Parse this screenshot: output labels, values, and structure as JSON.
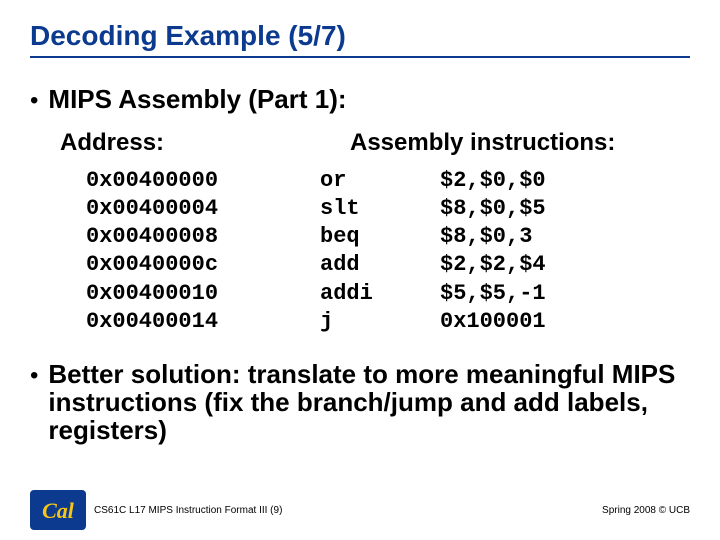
{
  "title": "Decoding Example (5/7)",
  "bullet_main": "MIPS Assembly (Part 1):",
  "column_headers": {
    "address": "Address:",
    "assembly": "Assembly instructions:"
  },
  "rows": [
    {
      "addr": "0x00400000",
      "mnem": "or",
      "args": "$2,$0,$0"
    },
    {
      "addr": "0x00400004",
      "mnem": "slt",
      "args": "$8,$0,$5"
    },
    {
      "addr": "0x00400008",
      "mnem": "beq",
      "args": "$8,$0,3"
    },
    {
      "addr": "0x0040000c",
      "mnem": "add",
      "args": "$2,$2,$4"
    },
    {
      "addr": "0x00400010",
      "mnem": "addi",
      "args": "$5,$5,-1"
    },
    {
      "addr": "0x00400014",
      "mnem": "j",
      "args": "0x100001"
    }
  ],
  "bullet_secondary": "Better solution: translate to more meaningful MIPS instructions (fix the branch/jump and add labels, registers)",
  "footer": {
    "left": "CS61C L17 MIPS Instruction Format III (9)",
    "right": "Spring 2008 © UCB"
  },
  "logo_text": "Cal"
}
